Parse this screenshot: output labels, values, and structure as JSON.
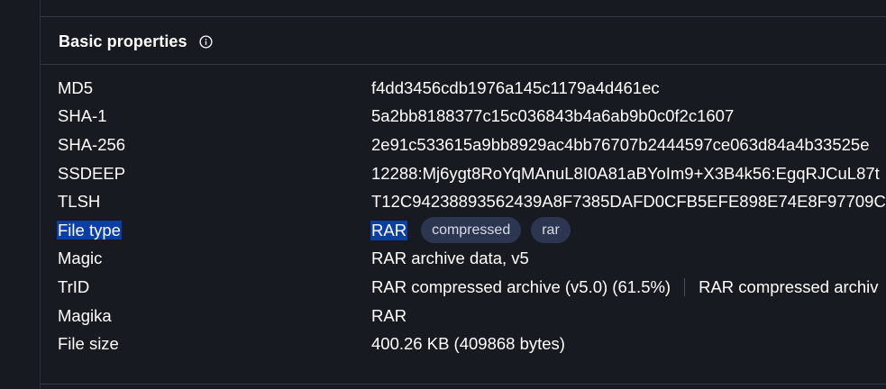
{
  "section": {
    "title": "Basic properties",
    "info_icon": "info-circle-icon"
  },
  "properties": [
    {
      "key": "MD5",
      "value": "f4dd3456cdb1976a145c1179a4d461ec"
    },
    {
      "key": "SHA-1",
      "value": "5a2bb8188377c15c036843b4a6ab9b0c0f2c1607"
    },
    {
      "key": "SHA-256",
      "value": "2e91c533615a9bb8929ac4bb76707b2444597ce063d84a4b33525e"
    },
    {
      "key": "SSDEEP",
      "value": "12288:Mj6ygt8RoYqMAnuL8I0A81aBYoIm9+X3B4k56:EgqRJCuL87t"
    },
    {
      "key": "TLSH",
      "value": "T12C94238893562439A8F7385DAFD0CFB5EFE898E74E8F97709CF"
    },
    {
      "key": "File type",
      "value": "RAR",
      "tags": [
        "compressed",
        "rar"
      ]
    },
    {
      "key": "Magic",
      "value": "RAR archive data, v5"
    },
    {
      "key": "TrID",
      "value": "RAR compressed archive (v5.0) (61.5%)",
      "value2": "RAR compressed archiv"
    },
    {
      "key": "Magika",
      "value": "RAR"
    },
    {
      "key": "File size",
      "value": "400.26 KB (409868 bytes)"
    }
  ],
  "colors": {
    "background": "#181a21",
    "selection": "#0b3fa8",
    "tag_background": "#2c3650"
  }
}
